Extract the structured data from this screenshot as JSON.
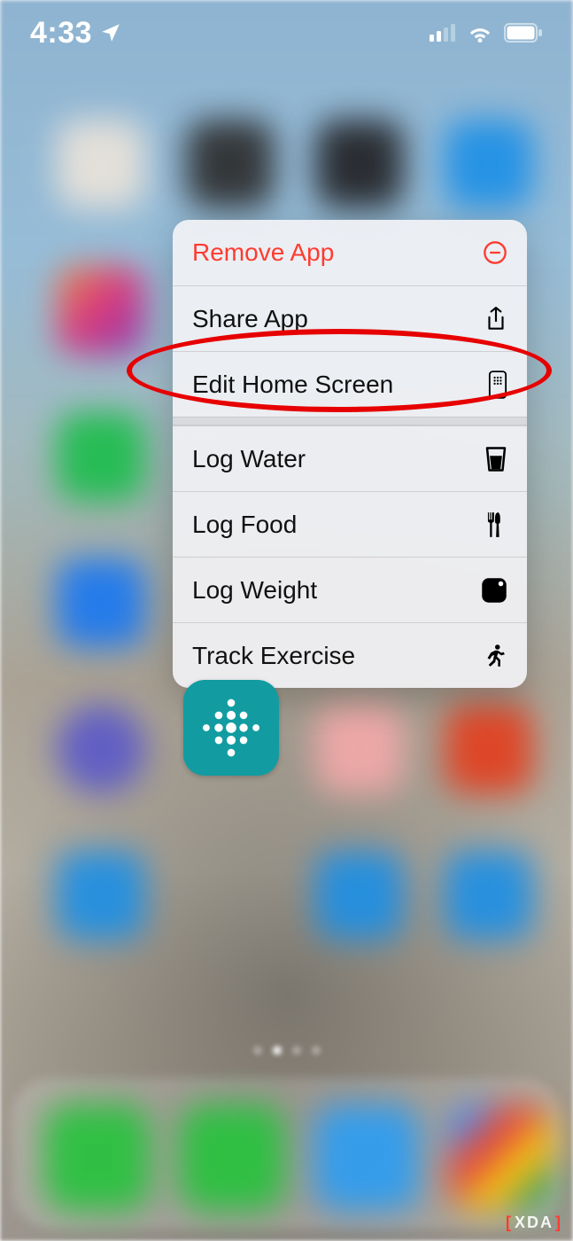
{
  "status": {
    "time": "4:33",
    "location_icon": "location-arrow"
  },
  "menu": {
    "remove_app": "Remove App",
    "share_app": "Share App",
    "edit_home_screen": "Edit Home Screen",
    "log_water": "Log Water",
    "log_food": "Log Food",
    "log_weight": "Log Weight",
    "track_exercise": "Track Exercise"
  },
  "app": {
    "name": "Fitbit"
  },
  "annotation": {
    "highlight_target": "edit-home-screen"
  },
  "watermark": {
    "text": "XDA"
  },
  "colors": {
    "destructive": "#ff3b30",
    "annotation": "#e60000",
    "app_accent": "#129ca1"
  }
}
